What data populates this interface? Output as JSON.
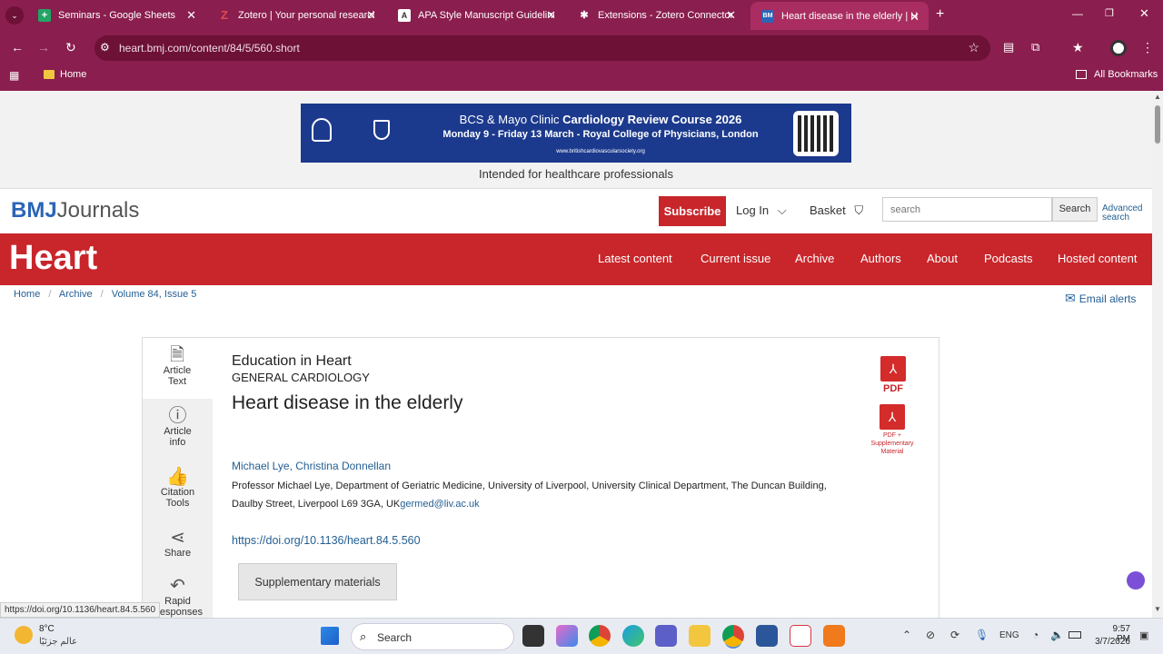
{
  "browser": {
    "tabs": [
      {
        "label": "Seminars - Google Sheets",
        "icon": "sheets-icon",
        "color": "#22a565",
        "glyph": "+"
      },
      {
        "label": "Zotero | Your personal research",
        "icon": "zotero-icon",
        "color": "#d6363d",
        "glyph": "Z"
      },
      {
        "label": "APA Style Manuscript Guideline",
        "icon": "doc-icon",
        "color": "#ffffff",
        "glyph": "A"
      },
      {
        "label": "Extensions - Zotero Connector",
        "icon": "puzzle-icon",
        "color": "#ffffff",
        "glyph": "✱"
      },
      {
        "label": "Heart disease in the elderly | He",
        "icon": "bmj-icon",
        "color": "#2b65b6",
        "glyph": "BM"
      }
    ],
    "url": "heart.bmj.com/content/84/5/560.short",
    "bookmark_home": "Home",
    "all_bookmarks": "All Bookmarks",
    "status_link": "https://doi.org/10.1136/heart.84.5.560"
  },
  "ad": {
    "title_plain": "BCS & Mayo Clinic",
    "title_bold": "Cardiology Review Course 2026",
    "line2": "Monday 9 - Friday 13 March - Royal College of Physicians, London",
    "url": "www.britishcardiovascularsociety.org",
    "intended": "Intended for healthcare professionals"
  },
  "header": {
    "logo_bmj": "BMJ",
    "logo_journals": "Journals",
    "subscribe": "Subscribe",
    "login": "Log In",
    "basket": "Basket",
    "search_placeholder": "search",
    "search_button": "Search",
    "advanced": "Advanced",
    "advanced2": "search"
  },
  "journal": {
    "name": "Heart",
    "nav": [
      "Latest content",
      "Current issue",
      "Archive",
      "Authors",
      "About",
      "Podcasts",
      "Hosted content"
    ]
  },
  "breadcrumb": [
    "Home",
    "Archive",
    "Volume 84, Issue 5"
  ],
  "email_alerts": "Email alerts",
  "sidenav": [
    {
      "label1": "Article",
      "label2": "Text"
    },
    {
      "label1": "Article",
      "label2": "info"
    },
    {
      "label1": "Citation",
      "label2": "Tools"
    },
    {
      "label1": "Share",
      "label2": ""
    },
    {
      "label1": "Rapid",
      "label2": "Responses"
    }
  ],
  "article": {
    "section": "Education in Heart",
    "subsection": "GENERAL CARDIOLOGY",
    "title": "Heart disease in the elderly",
    "author1": "Michael Lye",
    "author2": "Christina Donnellan",
    "affiliation1": "Professor Michael Lye, Department of Geriatric Medicine, University of Liverpool, University Clinical Department, The Duncan Building,",
    "affiliation2": "Daulby Street, Liverpool L69 3GA, UK",
    "email": "germed@liv.ac.uk",
    "doi": "https://doi.org/10.1136/heart.84.5.560",
    "supp_button": "Supplementary materials",
    "pdf": "PDF",
    "pdf_supp1": "PDF +",
    "pdf_supp2": "Supplementary",
    "pdf_supp3": "Material"
  },
  "taskbar": {
    "temp": "8°C",
    "weather_text": "عالم جزئيًا",
    "search": "Search",
    "lang": "ENG",
    "time": "9:57 PM",
    "date": "3/7/2026"
  }
}
